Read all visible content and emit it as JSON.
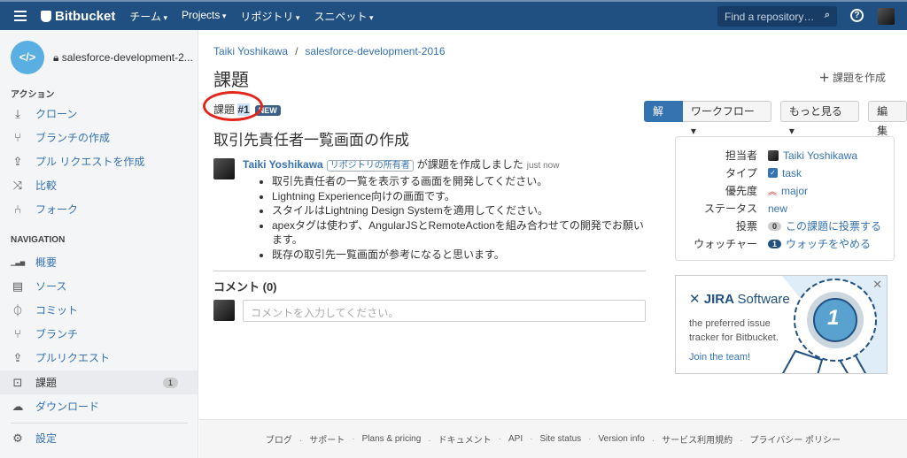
{
  "header": {
    "brand": "Bitbucket",
    "nav": [
      "チーム",
      "Projects",
      "リポジトリ",
      "スニペット"
    ],
    "search_placeholder": "Find a repository…",
    "help": "?"
  },
  "sidebar": {
    "repo_name": "salesforce-development-2...",
    "repo_icon": "</>",
    "actions_heading": "アクション",
    "actions": [
      {
        "label": "クローン",
        "icon": "⤓"
      },
      {
        "label": "ブランチの作成",
        "icon": "⑂"
      },
      {
        "label": "プル リクエストを作成",
        "icon": "⇪"
      },
      {
        "label": "比較",
        "icon": "⤨"
      },
      {
        "label": "フォーク",
        "icon": "⑃"
      }
    ],
    "nav_heading": "NAVIGATION",
    "nav": [
      {
        "label": "概要",
        "icon": "▁▃▅"
      },
      {
        "label": "ソース",
        "icon": "▤"
      },
      {
        "label": "コミット",
        "icon": "⏀"
      },
      {
        "label": "ブランチ",
        "icon": "⑂"
      },
      {
        "label": "プルリクエスト",
        "icon": "⇪"
      },
      {
        "label": "課題",
        "icon": "⊡",
        "badge": "1",
        "selected": true
      },
      {
        "label": "ダウンロード",
        "icon": "☁"
      }
    ],
    "settings": {
      "label": "設定",
      "icon": "⚙"
    }
  },
  "main": {
    "breadcrumb": [
      "Taiki Yoshikawa",
      "salesforce-development-2016"
    ],
    "breadcrumb_sep": "/",
    "page_title": "課題",
    "create_label": "課題を作成",
    "issue_label": "課題",
    "issue_number": "#1",
    "status_badge": "NEW",
    "buttons": {
      "resolve": "解決",
      "workflow": "ワークフロー",
      "more": "もっと見る",
      "edit": "編集"
    },
    "issue_title": "取引先責任者一覧画面の作成",
    "activity": {
      "user": "Taiki Yoshikawa",
      "role": "リポジトリの所有者",
      "action": "が課題を作成しました",
      "time": "just now",
      "items": [
        "取引先責任者の一覧を表示する画面を開発してください。",
        "Lightning Experience向けの画面です。",
        "スタイルはLightning Design Systemを適用してください。",
        "apexタグは使わず、AngularJSとRemoteActionを組み合わせての開発でお願います。",
        "既存の取引先一覧画面が参考になると思います。"
      ]
    },
    "comments_heading": "コメント (0)",
    "comment_placeholder": "コメントを入力してください。",
    "meta": {
      "assignee_k": "担当者",
      "assignee": "Taiki Yoshikawa",
      "type_k": "タイプ",
      "type": "task",
      "priority_k": "優先度",
      "priority": "major",
      "status_k": "ステータス",
      "status": "new",
      "votes_k": "投票",
      "votes": "0",
      "vote_link": "この課題に投票する",
      "watchers_k": "ウォッチャー",
      "watchers": "1",
      "watch_link": "ウォッチをやめる"
    },
    "promo": {
      "brand": "JIRA",
      "product": "Software",
      "text1": "the preferred issue",
      "text2": "tracker for Bitbucket.",
      "link": "Join the team!",
      "medal": "1"
    }
  },
  "footer": [
    "ブログ",
    "サポート",
    "Plans & pricing",
    "ドキュメント",
    "API",
    "Site status",
    "Version info",
    "サービス利用規約",
    "プライバシー ポリシー"
  ],
  "colors": {
    "header": "#205081",
    "link": "#3572b0",
    "accent_ring": "#e3261c"
  }
}
